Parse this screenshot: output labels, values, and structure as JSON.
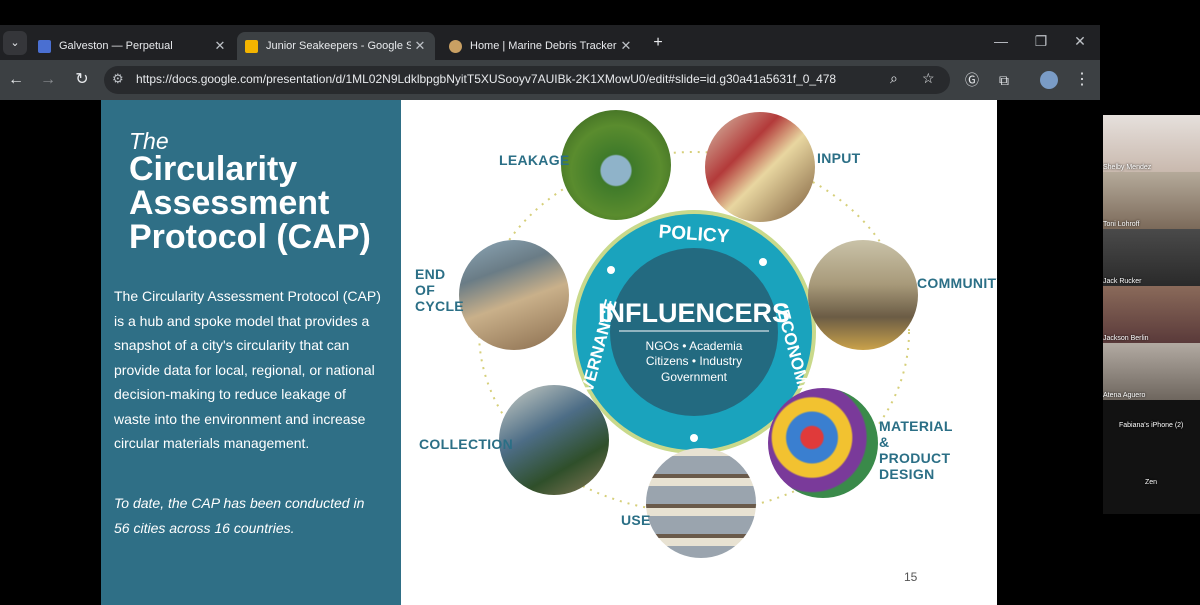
{
  "browser": {
    "tabs": [
      {
        "title": "Galveston — Perpetual",
        "icon": "calendar-favicon",
        "color": "#4a6fd1"
      },
      {
        "title": "Junior Seakeepers - Google Slid",
        "icon": "slides-favicon",
        "color": "#f4b400"
      },
      {
        "title": "Home | Marine Debris Tracker",
        "icon": "debris-tracker-favicon",
        "color": "#c9a063"
      }
    ],
    "url": "https://docs.google.com/presentation/d/1ML02N9LdklbpgbNyitT5XUSooyv7AUIBk-2K1XMowU0/edit#slide=id.g30a41a5631f_0_478"
  },
  "slide": {
    "the": "The",
    "title": "Circularity Assessment Protocol (CAP)",
    "description": "The Circularity Assessment Protocol (CAP) is a hub and spoke model that provides a snapshot of a city's circularity that can provide data for local, regional, or national decision-making to reduce leakage of waste into the environment and increase circular materials management.",
    "to_date": "To date, the CAP has been conducted in 56 cities across 16 countries.",
    "page_number": "15",
    "diagram": {
      "center_title": "INFLUENCERS",
      "center_lines": [
        "NGOs • Academia",
        "Citizens • Industry",
        "Government"
      ],
      "ring_words": [
        "POLICY",
        "ECONOMICS",
        "GOVERNANCE"
      ],
      "spokes": [
        "LEAKAGE",
        "INPUT",
        "END OF CYCLE",
        "COMMUNITY",
        "COLLECTION",
        "MATERIAL & PRODUCT DESIGN",
        "USE"
      ],
      "colors": {
        "teal": "#2b6f86",
        "ring": "#1aa3bd",
        "ring_border": "#c9d98b",
        "center": "#236a80"
      }
    }
  },
  "participants": [
    {
      "name": "Shelby Mendez"
    },
    {
      "name": "Toni Lohroff"
    },
    {
      "name": "Jack Rucker"
    },
    {
      "name": "Jackson Berlin"
    },
    {
      "name": "Atena Aguero"
    },
    {
      "name": "Fabiana's iPhone (2)"
    },
    {
      "name": "Zen"
    }
  ]
}
